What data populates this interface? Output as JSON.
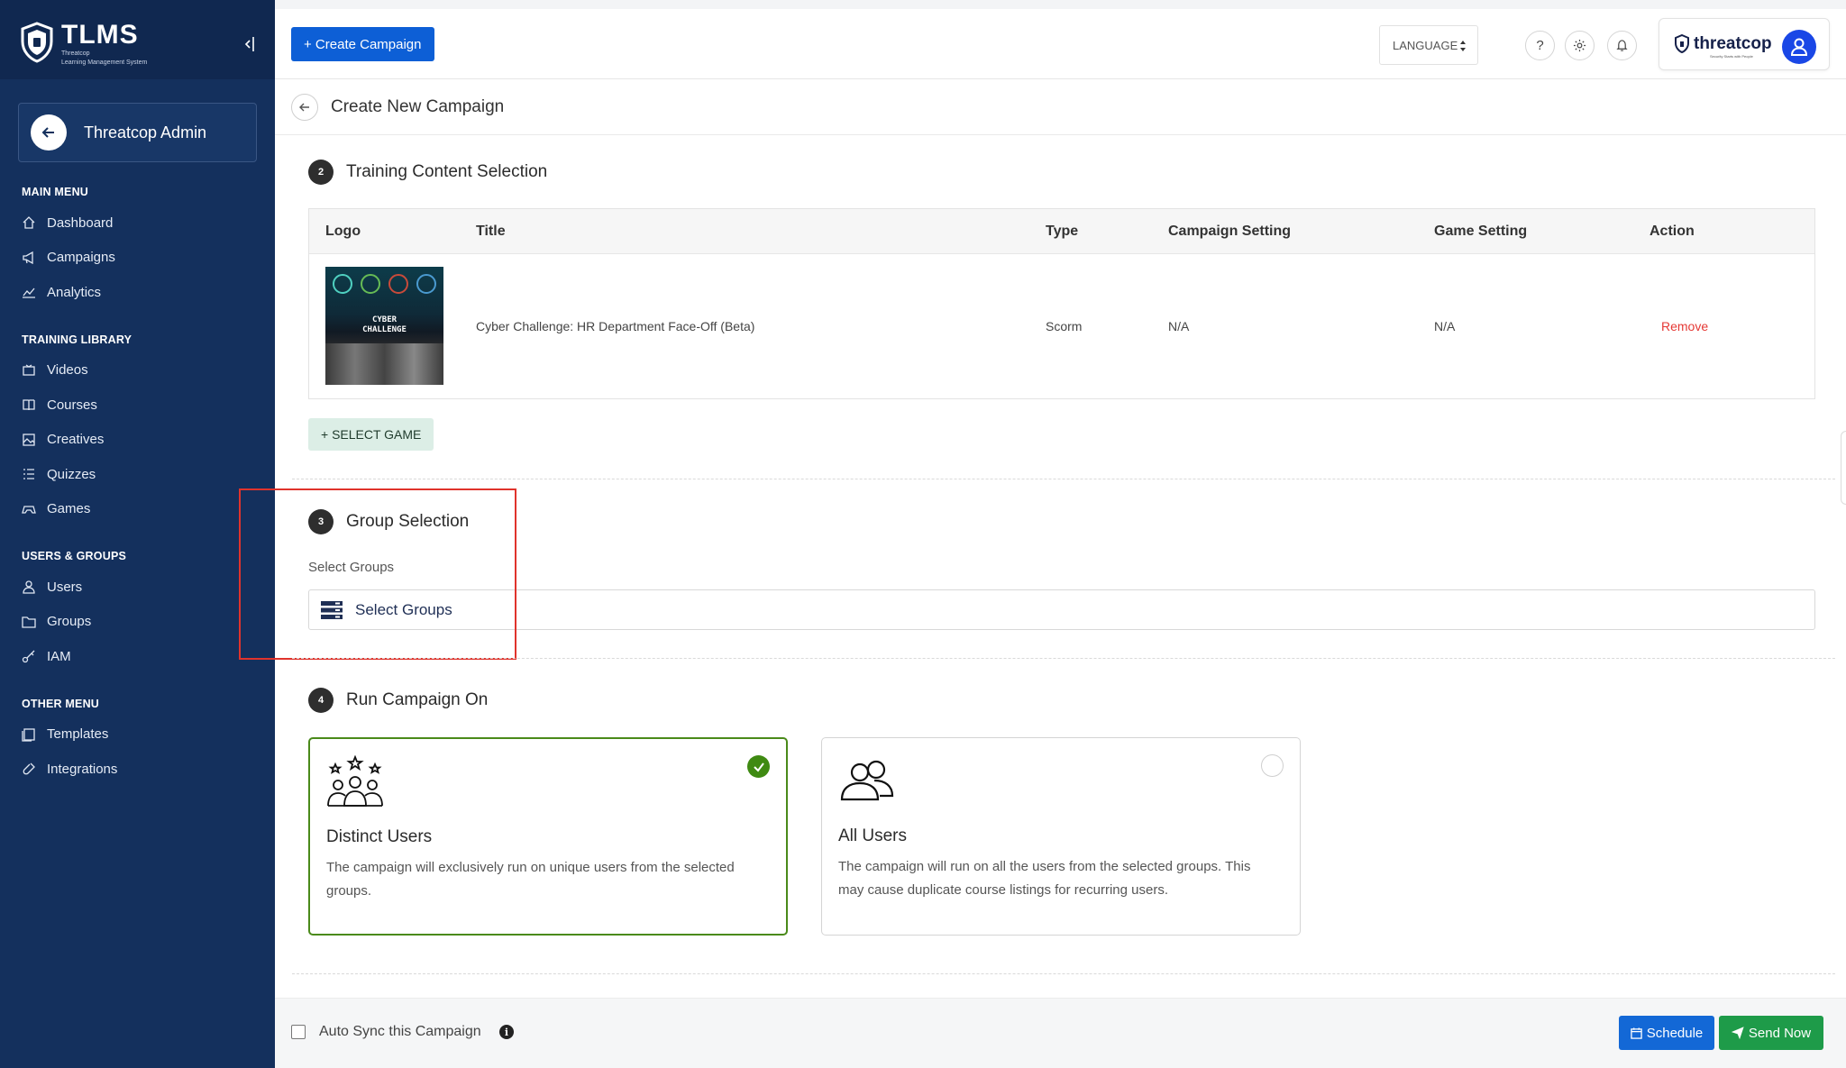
{
  "brand": {
    "name": "TLMS",
    "subtitle_line1": "Threatcop",
    "subtitle_line2": "Learning Management System"
  },
  "admin": {
    "label": "Threatcop Admin"
  },
  "sidebar": {
    "sections": [
      {
        "title": "MAIN MENU",
        "items": [
          {
            "label": "Dashboard",
            "icon": "home-icon"
          },
          {
            "label": "Campaigns",
            "icon": "megaphone-icon"
          },
          {
            "label": "Analytics",
            "icon": "chart-line-icon"
          }
        ]
      },
      {
        "title": "TRAINING LIBRARY",
        "items": [
          {
            "label": "Videos",
            "icon": "video-icon"
          },
          {
            "label": "Courses",
            "icon": "book-icon"
          },
          {
            "label": "Creatives",
            "icon": "image-icon"
          },
          {
            "label": "Quizzes",
            "icon": "list-icon"
          },
          {
            "label": "Games",
            "icon": "gamepad-icon"
          }
        ]
      },
      {
        "title": "USERS & GROUPS",
        "items": [
          {
            "label": "Users",
            "icon": "user-icon"
          },
          {
            "label": "Groups",
            "icon": "folder-icon"
          },
          {
            "label": "IAM",
            "icon": "key-icon"
          }
        ]
      },
      {
        "title": "OTHER MENU",
        "items": [
          {
            "label": "Templates",
            "icon": "template-icon"
          },
          {
            "label": "Integrations",
            "icon": "link-icon"
          }
        ]
      }
    ]
  },
  "topbar": {
    "create_label": "+ Create Campaign",
    "language_label": "LANGUAGE",
    "help_symbol": "?",
    "logo_text": "threatcop",
    "logo_tagline": "Security Starts with People"
  },
  "page": {
    "title": "Create New Campaign"
  },
  "training": {
    "step": "2",
    "title": "Training Content Selection",
    "columns": [
      "Logo",
      "Title",
      "Type",
      "Campaign Setting",
      "Game Setting",
      "Action"
    ],
    "row": {
      "thumb_text_line1": "CYBER",
      "thumb_text_line2": "CHALLENGE",
      "title": "Cyber Challenge: HR Department Face-Off (Beta)",
      "type": "Scorm",
      "campaign_setting": "N/A",
      "game_setting": "N/A",
      "action": "Remove"
    },
    "select_game_label": "+ SELECT GAME"
  },
  "groups": {
    "step": "3",
    "title": "Group Selection",
    "label": "Select Groups",
    "field_text": "Select Groups"
  },
  "run_on": {
    "step": "4",
    "title": "Run Campaign On",
    "options": [
      {
        "title": "Distinct Users",
        "desc": "The campaign will exclusively run on unique users from the selected groups.",
        "selected": true
      },
      {
        "title": "All Users",
        "desc": "The campaign will run on all the users from the selected groups. This may cause duplicate course listings for recurring users.",
        "selected": false
      }
    ]
  },
  "footer": {
    "sync_label": "Auto Sync this Campaign",
    "schedule_label": "Schedule",
    "send_label": "Send Now"
  },
  "colors": {
    "sidebar_bg": "#14305d",
    "primary": "#0d5fd6",
    "success": "#1e9b49",
    "selected_border": "#4a8a1a",
    "danger": "#e53935",
    "highlight": "#e0332c"
  }
}
